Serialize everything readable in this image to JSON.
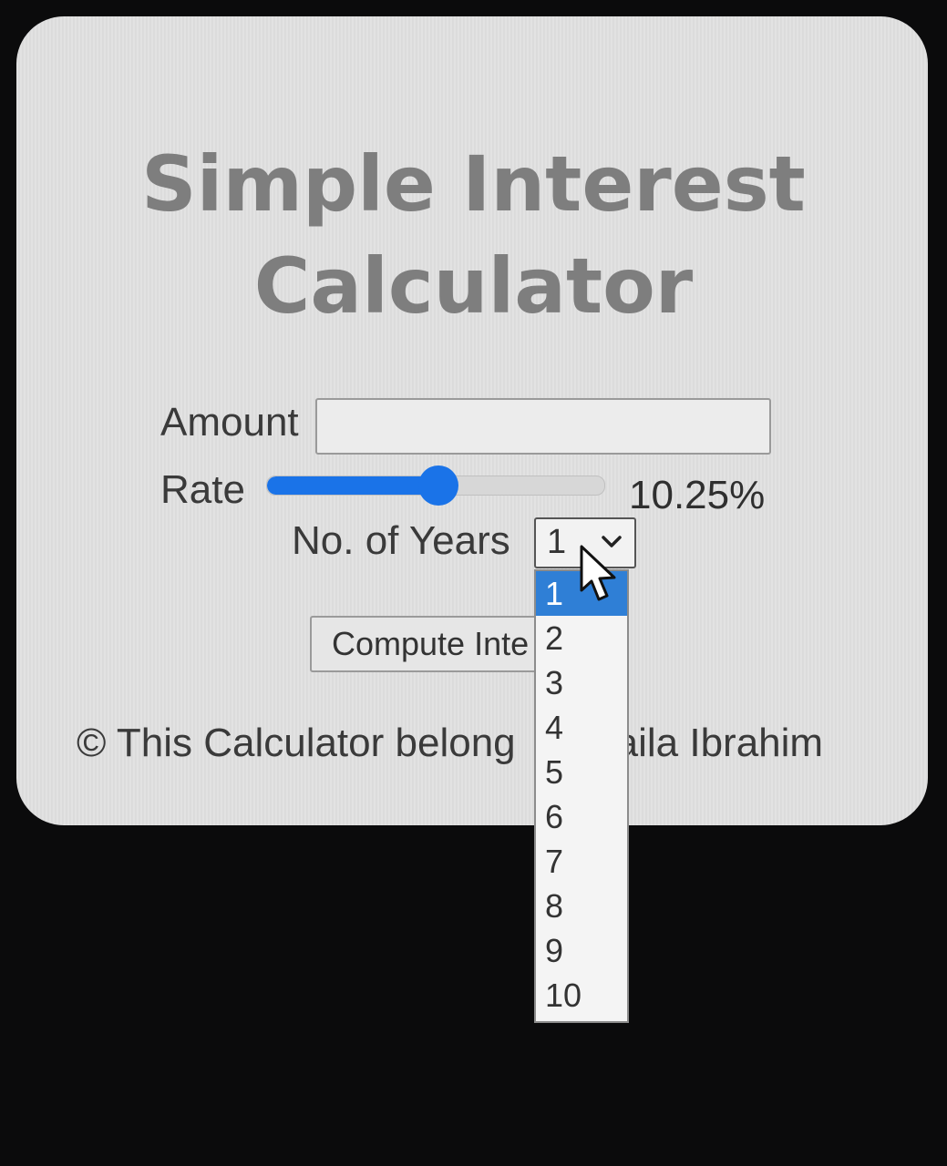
{
  "calculator": {
    "title_line1": "Simple Interest",
    "title_line2": "Calculator",
    "amount": {
      "label": "Amount",
      "value": ""
    },
    "rate": {
      "label": "Rate",
      "value_text": "10.25%",
      "slider_fraction": 0.51,
      "accent_color": "#1a73e8"
    },
    "years": {
      "label": "No. of Years",
      "selected": "1",
      "options": [
        "1",
        "2",
        "3",
        "4",
        "5",
        "6",
        "7",
        "8",
        "9",
        "10"
      ],
      "highlighted_option": "1",
      "highlight_color": "#2f7fd6"
    },
    "compute_button_label": "Compute Inte",
    "footer": {
      "before": "© This Calculator belong",
      "after": "aila Ibrahim"
    }
  },
  "icons": {
    "dropdown_arrow": "chevron-down-icon",
    "pointer": "cursor-icon"
  }
}
